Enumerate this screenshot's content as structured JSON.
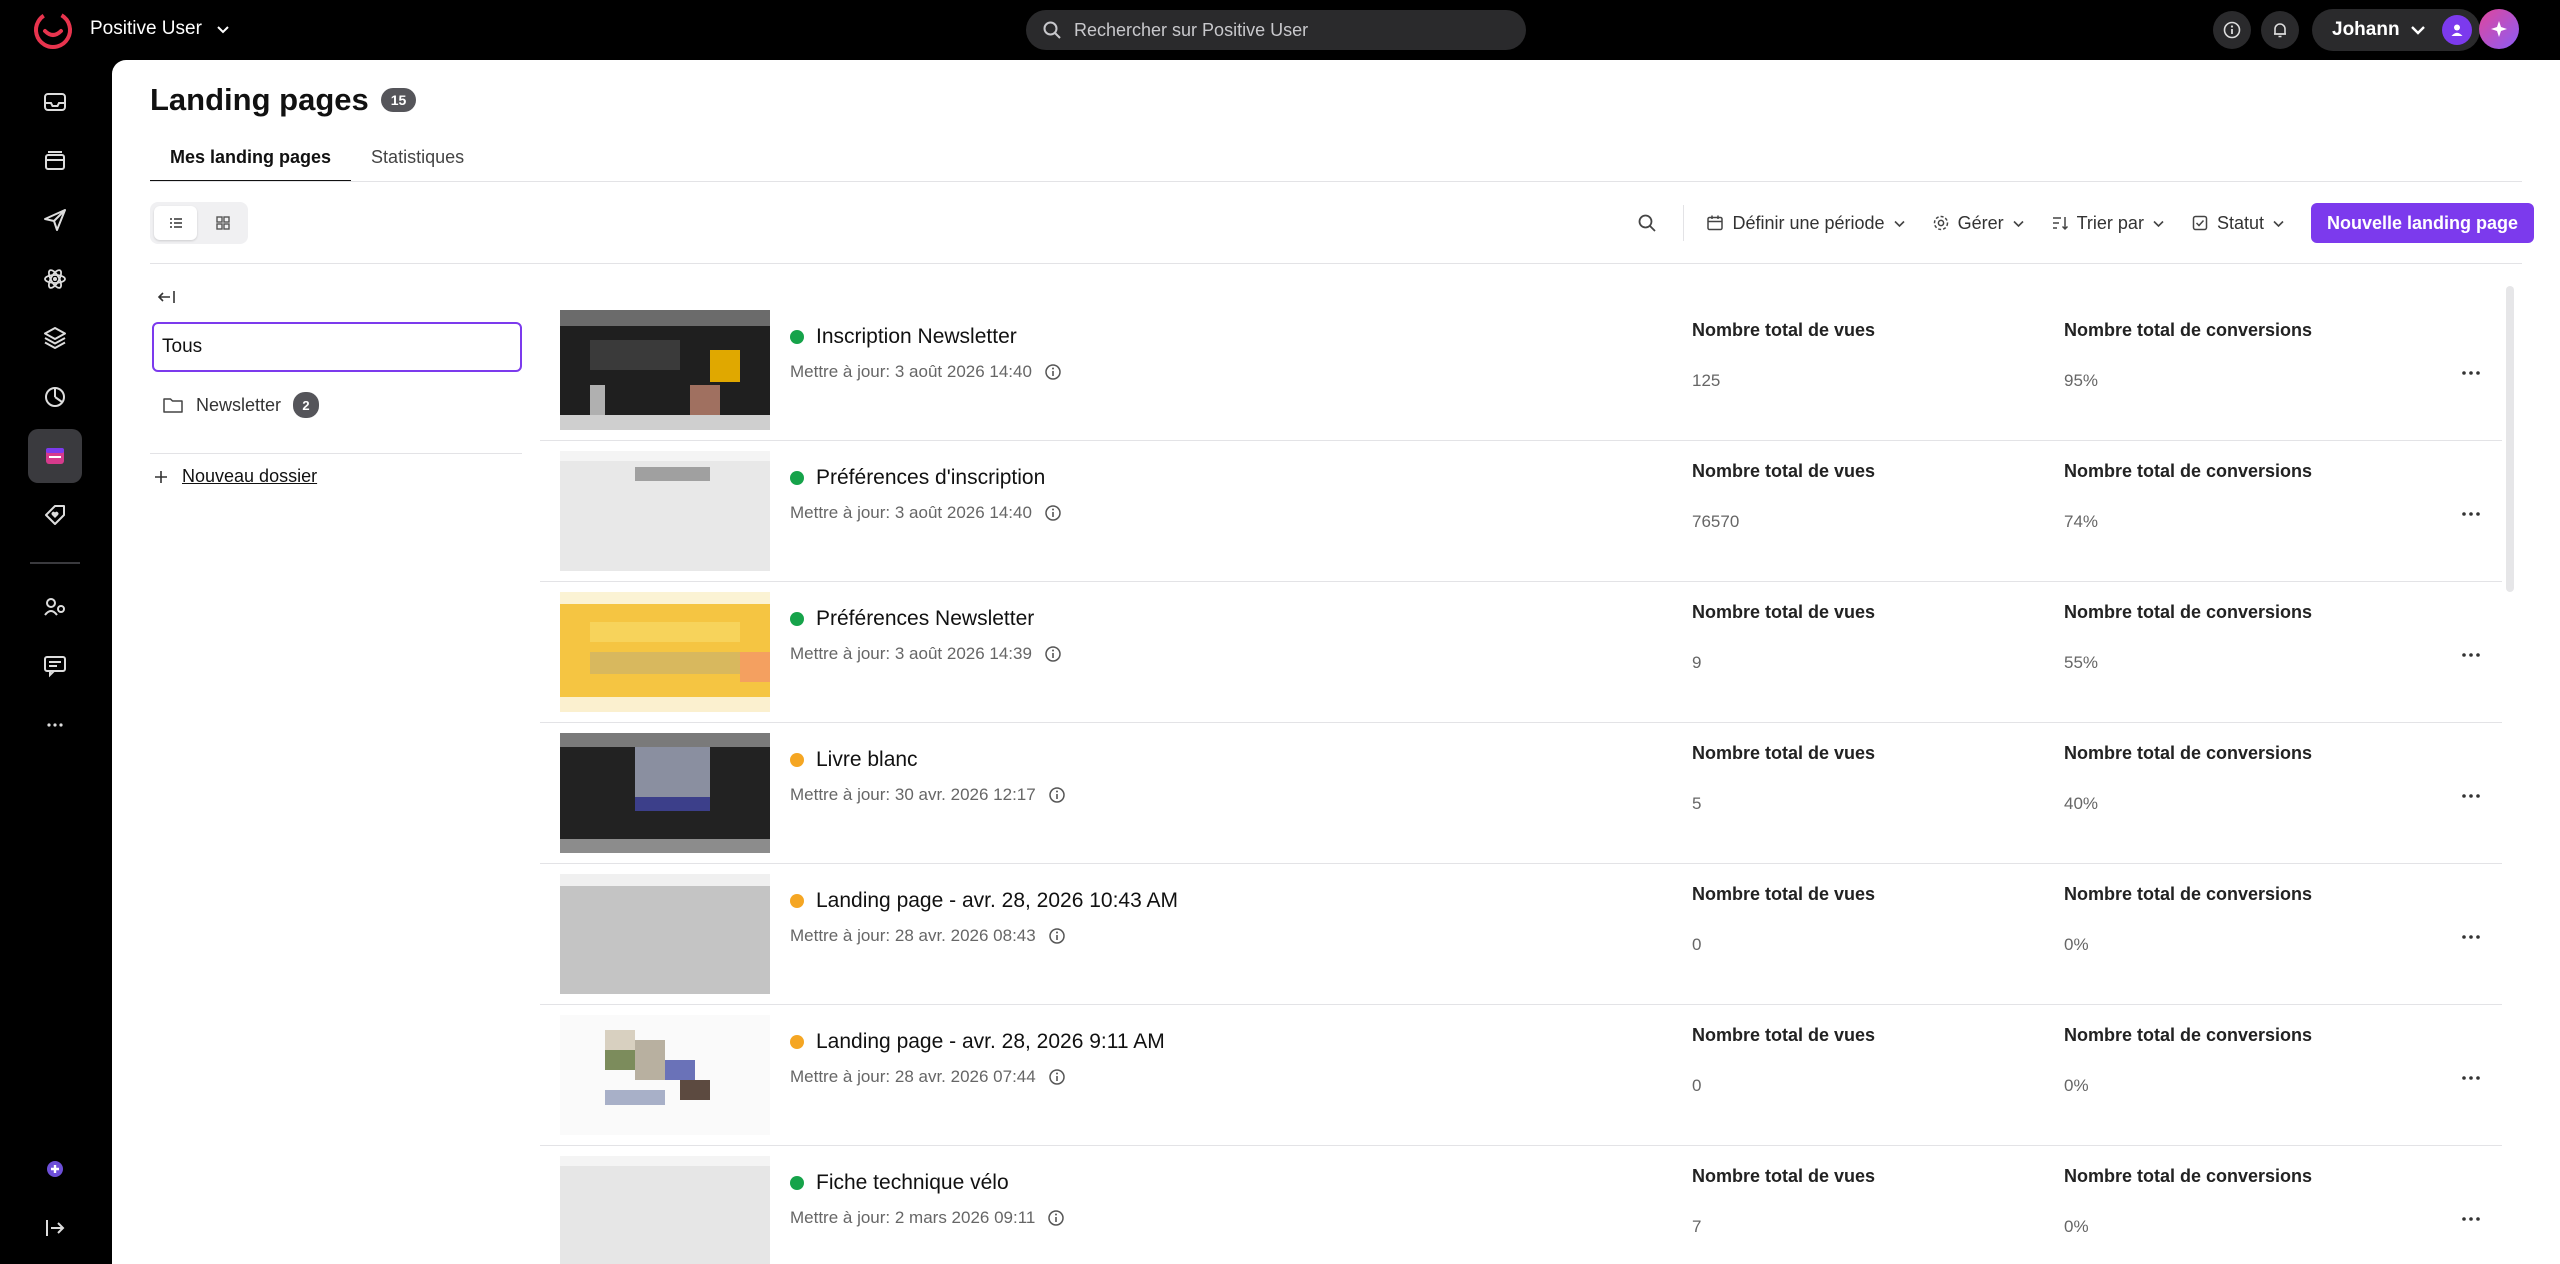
{
  "app": {
    "workspace": "Positive User",
    "search_placeholder": "Rechercher sur Positive User",
    "user_name": "Johann",
    "accent_color": "#7c3aed"
  },
  "sidebar": {
    "items": [
      {
        "icon": "inbox-icon",
        "active": false
      },
      {
        "icon": "archive-icon",
        "active": false
      },
      {
        "icon": "send-icon",
        "active": false
      },
      {
        "icon": "atom-icon",
        "active": false
      },
      {
        "icon": "layers-icon",
        "active": false
      },
      {
        "icon": "chart-pie-icon",
        "active": false
      },
      {
        "icon": "landing-page-icon",
        "active": true
      },
      {
        "icon": "tag-heart-icon",
        "active": false
      },
      {
        "icon": "user-flow-icon",
        "active": false
      },
      {
        "icon": "chat-icon",
        "active": false
      },
      {
        "icon": "more-icon",
        "active": false
      },
      {
        "icon": "integration-icon",
        "active": false
      },
      {
        "icon": "logout-icon",
        "active": false
      }
    ]
  },
  "page": {
    "title": "Landing pages",
    "count": "15",
    "tabs": [
      {
        "label": "Mes landing pages",
        "active": true
      },
      {
        "label": "Statistiques",
        "active": false
      }
    ]
  },
  "toolbar": {
    "period": "Définir une période",
    "manage": "Gérer",
    "sort": "Trier par",
    "status": "Statut",
    "new_button": "Nouvelle landing page"
  },
  "folders": {
    "search_value": "Tous",
    "items": [
      {
        "label": "Newsletter",
        "count": "2"
      }
    ],
    "new_folder": "Nouveau dossier"
  },
  "list": {
    "views_label": "Nombre total de vues",
    "conversions_label": "Nombre total de conversions",
    "rows": [
      {
        "title": "Inscription Newsletter",
        "status": "published",
        "status_color": "#16a34a",
        "updated": "Mettre à jour: 3 août 2026 14:40",
        "views": "125",
        "conversions": "95%"
      },
      {
        "title": "Préférences d'inscription",
        "status": "published",
        "status_color": "#16a34a",
        "updated": "Mettre à jour: 3 août 2026 14:40",
        "views": "76570",
        "conversions": "74%"
      },
      {
        "title": "Préférences Newsletter",
        "status": "published",
        "status_color": "#16a34a",
        "updated": "Mettre à jour: 3 août 2026 14:39",
        "views": "9",
        "conversions": "55%"
      },
      {
        "title": "Livre blanc",
        "status": "draft",
        "status_color": "#f5a623",
        "updated": "Mettre à jour: 30 avr. 2026 12:17",
        "views": "5",
        "conversions": "40%"
      },
      {
        "title": "Landing page - avr. 28, 2026 10:43 AM",
        "status": "draft",
        "status_color": "#f5a623",
        "updated": "Mettre à jour: 28 avr. 2026 08:43",
        "views": "0",
        "conversions": "0%"
      },
      {
        "title": "Landing page - avr. 28, 2026 9:11 AM",
        "status": "draft",
        "status_color": "#f5a623",
        "updated": "Mettre à jour: 28 avr. 2026 07:44",
        "views": "0",
        "conversions": "0%"
      },
      {
        "title": "Fiche technique vélo",
        "status": "published",
        "status_color": "#16a34a",
        "updated": "Mettre à jour: 2 mars 2026 09:11",
        "views": "7",
        "conversions": "0%"
      }
    ]
  }
}
